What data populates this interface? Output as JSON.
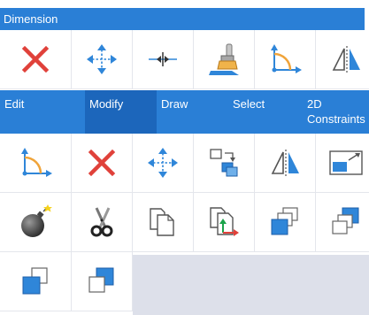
{
  "panel": {
    "title": "Dimension"
  },
  "tabs": [
    {
      "label": "Edit",
      "active": false
    },
    {
      "label": "Modify",
      "active": true
    },
    {
      "label": "Draw",
      "active": false
    },
    {
      "label": "Select",
      "active": false
    },
    {
      "label": "2D Constraints",
      "active": false
    }
  ],
  "top_tools": [
    "delete-icon",
    "move-icon",
    "break-icon",
    "match-properties-icon",
    "dimension-angle-icon",
    "mirror-icon"
  ],
  "modify_tools": [
    "dimension-angle-icon",
    "delete-icon",
    "move-icon",
    "copy-stack-icon",
    "mirror-icon",
    "scale-icon",
    "explode-bomb-icon",
    "trim-scissors-icon",
    "copy-pages-icon",
    "copy-with-basepoint-icon",
    "bring-to-front-icon",
    "send-to-back-icon",
    "bring-above-icon",
    "send-under-icon"
  ],
  "colors": {
    "header_blue": "#2a7fd6",
    "active_tab": "#1c66bb",
    "delete_red": "#e0413a",
    "icon_blue": "#2f86d9",
    "empty_area": "#dde0ea"
  }
}
